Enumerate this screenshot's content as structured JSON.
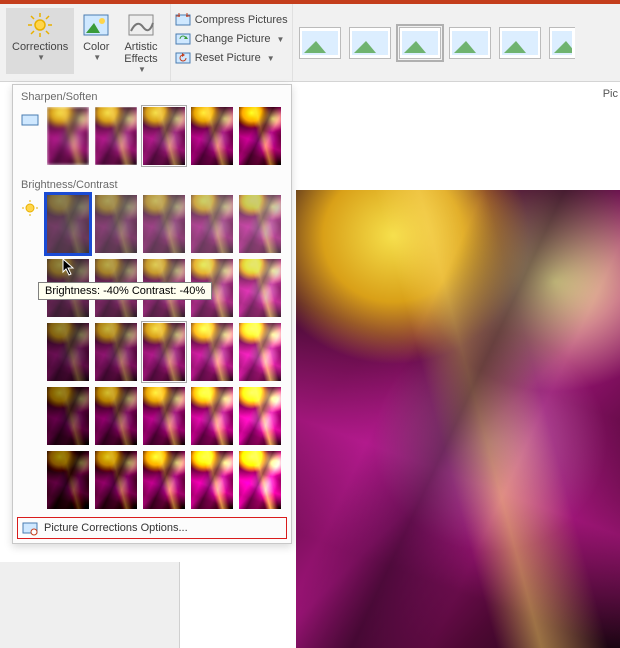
{
  "ribbon": {
    "corrections": "Corrections",
    "color": "Color",
    "artistic": "Artistic\nEffects",
    "compress": "Compress Pictures",
    "change": "Change Picture",
    "reset": "Reset Picture"
  },
  "right_label": "Pic",
  "dropdown": {
    "sharpen_label": "Sharpen/Soften",
    "brightness_label": "Brightness/Contrast",
    "footer": "Picture Corrections Options...",
    "sharpen_presets": [
      {
        "filter": "blur(1.5px)"
      },
      {
        "filter": "blur(.7px)"
      },
      {
        "filter": "none",
        "current": true
      },
      {
        "filter": "contrast(1.15) saturate(1.05)"
      },
      {
        "filter": "contrast(1.35) saturate(1.1)"
      }
    ],
    "brightness_presets": [
      [
        {
          "b": -40,
          "c": -40,
          "sel": true
        },
        {
          "b": -20,
          "c": -40
        },
        {
          "b": 0,
          "c": -40
        },
        {
          "b": 20,
          "c": -40
        },
        {
          "b": 40,
          "c": -40
        }
      ],
      [
        {
          "b": -40,
          "c": -20
        },
        {
          "b": -20,
          "c": -20
        },
        {
          "b": 0,
          "c": -20
        },
        {
          "b": 20,
          "c": -20
        },
        {
          "b": 40,
          "c": -20
        }
      ],
      [
        {
          "b": -40,
          "c": 0
        },
        {
          "b": -20,
          "c": 0
        },
        {
          "b": 0,
          "c": 0,
          "current": true
        },
        {
          "b": 20,
          "c": 0
        },
        {
          "b": 40,
          "c": 0
        }
      ],
      [
        {
          "b": -40,
          "c": 20
        },
        {
          "b": -20,
          "c": 20
        },
        {
          "b": 0,
          "c": 20
        },
        {
          "b": 20,
          "c": 20
        },
        {
          "b": 40,
          "c": 20
        }
      ],
      [
        {
          "b": -40,
          "c": 40
        },
        {
          "b": -20,
          "c": 40
        },
        {
          "b": 0,
          "c": 40
        },
        {
          "b": 20,
          "c": 40
        },
        {
          "b": 40,
          "c": 40
        }
      ]
    ]
  },
  "tooltip": "Brightness: -40% Contrast: -40%"
}
